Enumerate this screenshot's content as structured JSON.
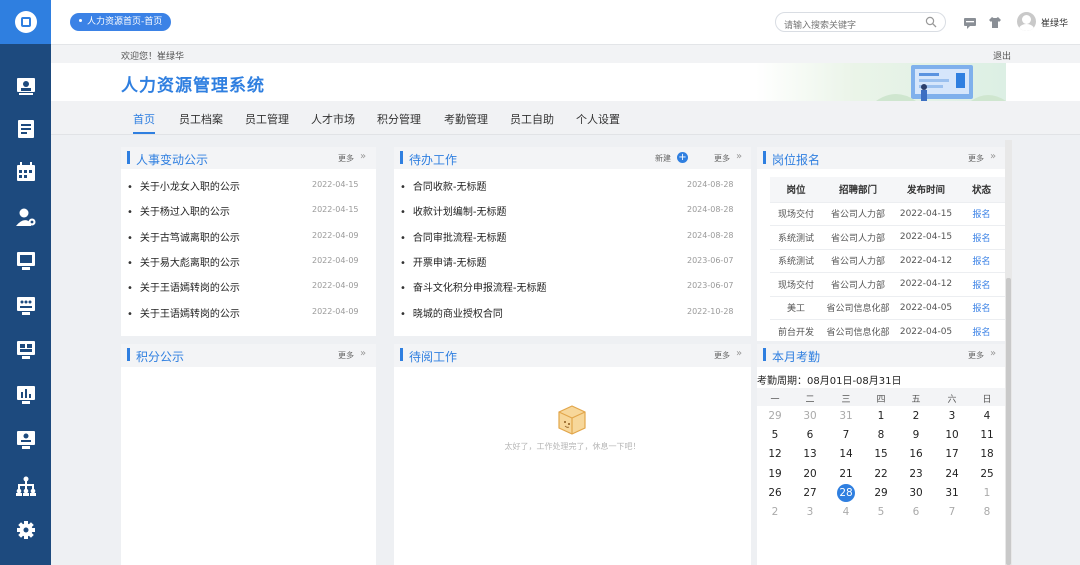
{
  "topbar": {
    "breadcrumb": "人力资源首页-首页",
    "search_placeholder": "请输入搜索关键字",
    "username": "崔绿华"
  },
  "welcome": {
    "text": "欢迎您！崔绿华",
    "logout": "退出"
  },
  "header": {
    "title": "人力资源管理系统"
  },
  "menu": [
    "首页",
    "员工档案",
    "员工管理",
    "人才市场",
    "积分管理",
    "考勤管理",
    "员工自助",
    "个人设置"
  ],
  "hr_notices": {
    "title": "人事变动公示",
    "more": "更多",
    "items": [
      {
        "text": "关于小龙女入职的公示",
        "date": "2022-04-15"
      },
      {
        "text": "关于杨过入职的公示",
        "date": "2022-04-15"
      },
      {
        "text": "关于古笃诚离职的公示",
        "date": "2022-04-09"
      },
      {
        "text": "关于易大彪离职的公示",
        "date": "2022-04-09"
      },
      {
        "text": "关于王语嫣转岗的公示",
        "date": "2022-04-09"
      },
      {
        "text": "关于王语嫣转岗的公示",
        "date": "2022-04-09"
      }
    ]
  },
  "todo": {
    "title": "待办工作",
    "new": "新建",
    "more": "更多",
    "items": [
      {
        "text": "合同收款-无标题",
        "date": "2024-08-28"
      },
      {
        "text": "收款计划编制-无标题",
        "date": "2024-08-28"
      },
      {
        "text": "合同审批流程-无标题",
        "date": "2024-08-28"
      },
      {
        "text": "开票申请-无标题",
        "date": "2023-06-07"
      },
      {
        "text": "奋斗文化积分申报流程-无标题",
        "date": "2023-06-07"
      },
      {
        "text": "晓城的商业授权合同",
        "date": "2022-10-28"
      }
    ]
  },
  "posts": {
    "title": "岗位报名",
    "more": "更多",
    "headers": [
      "岗位",
      "招聘部门",
      "发布时间",
      "状态"
    ],
    "rows": [
      [
        "现场交付",
        "省公司人力部",
        "2022-04-15",
        "报名"
      ],
      [
        "系统测试",
        "省公司人力部",
        "2022-04-15",
        "报名"
      ],
      [
        "系统测试",
        "省公司人力部",
        "2022-04-12",
        "报名"
      ],
      [
        "现场交付",
        "省公司人力部",
        "2022-04-12",
        "报名"
      ],
      [
        "美工",
        "省公司信息化部",
        "2022-04-05",
        "报名"
      ],
      [
        "前台开发",
        "省公司信息化部",
        "2022-04-05",
        "报名"
      ]
    ]
  },
  "points": {
    "title": "积分公示",
    "more": "更多"
  },
  "toread": {
    "title": "待阅工作",
    "more": "更多",
    "empty": "太好了，工作处理完了，休息一下吧！"
  },
  "attendance": {
    "title": "本月考勤",
    "more": "更多",
    "period": "考勤周期：08月01日-08月31日",
    "weekdays": [
      "一",
      "二",
      "三",
      "四",
      "五",
      "六",
      "日"
    ],
    "weeks": [
      [
        "29",
        "30",
        "31",
        "1",
        "2",
        "3",
        "4"
      ],
      [
        "5",
        "6",
        "7",
        "8",
        "9",
        "10",
        "11"
      ],
      [
        "12",
        "13",
        "14",
        "15",
        "16",
        "17",
        "18"
      ],
      [
        "19",
        "20",
        "21",
        "22",
        "23",
        "24",
        "25"
      ],
      [
        "26",
        "27",
        "28",
        "29",
        "30",
        "31",
        "1"
      ],
      [
        "2",
        "3",
        "4",
        "5",
        "6",
        "7",
        "8"
      ]
    ],
    "today": "28"
  }
}
